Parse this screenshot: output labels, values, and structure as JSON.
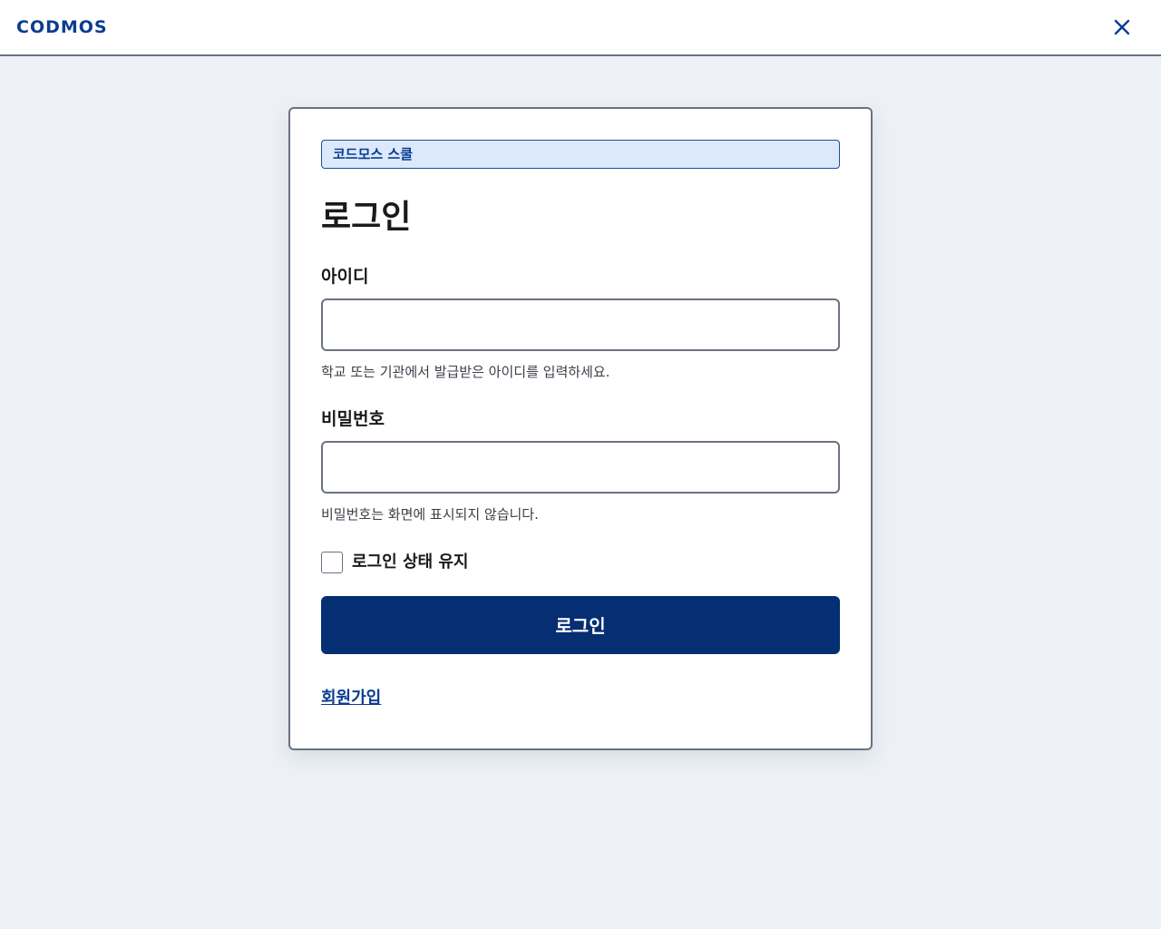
{
  "header": {
    "brand": "CODMOS",
    "close_icon": "close-icon"
  },
  "login": {
    "school_badge": "코드모스 스쿨",
    "title": "로그인",
    "id": {
      "label": "아이디",
      "value": "",
      "hint": "학교 또는 기관에서 발급받은 아이디를 입력하세요."
    },
    "password": {
      "label": "비밀번호",
      "value": "",
      "hint": "비밀번호는 화면에 표시되지 않습니다."
    },
    "remember": {
      "label": "로그인 상태 유지",
      "checked": false
    },
    "submit_label": "로그인",
    "signup_label": "회원가입"
  },
  "colors": {
    "brand": "#0a3d91",
    "primary_button": "#052e73",
    "badge_bg": "#dce9fb",
    "page_bg": "#edf1f6"
  }
}
